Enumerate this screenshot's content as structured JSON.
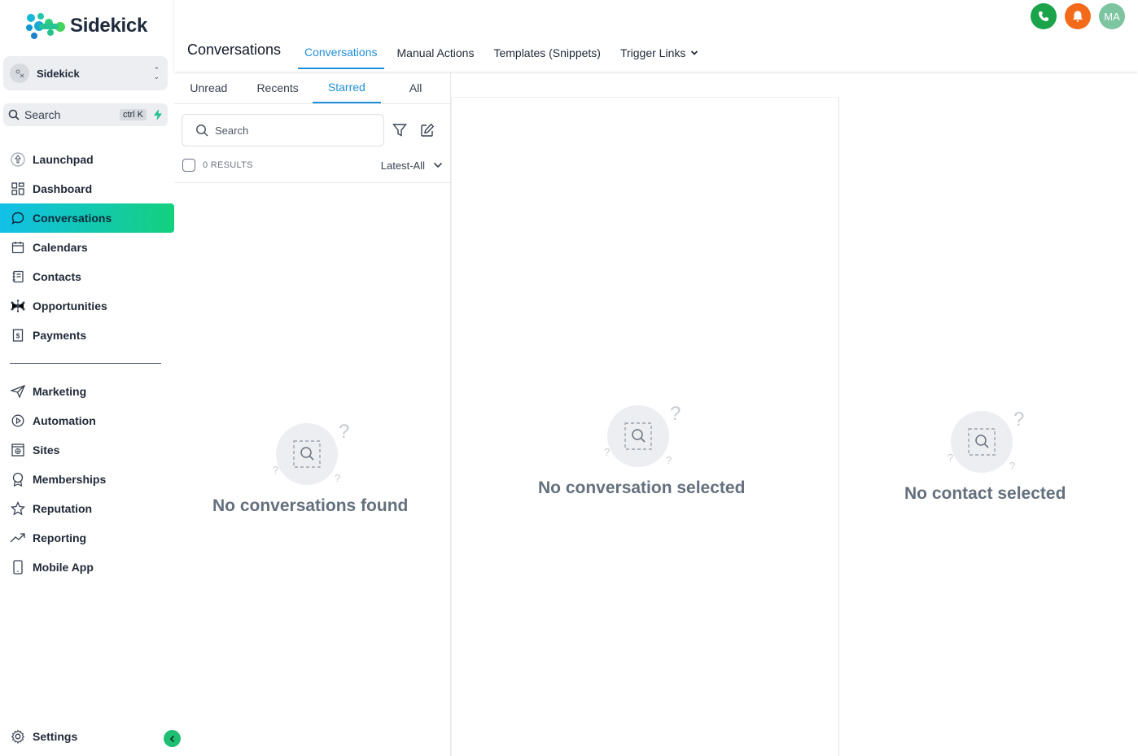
{
  "brand": {
    "name": "Sidekick"
  },
  "account": {
    "name": "Sidekick"
  },
  "sidebar_search": {
    "label": "Search",
    "shortcut": "ctrl K"
  },
  "nav_primary": [
    {
      "label": "Launchpad",
      "icon": "rocket-icon"
    },
    {
      "label": "Dashboard",
      "icon": "grid-icon"
    },
    {
      "label": "Conversations",
      "icon": "chat-bubble-icon",
      "active": true
    },
    {
      "label": "Calendars",
      "icon": "calendar-icon"
    },
    {
      "label": "Contacts",
      "icon": "contacts-book-icon"
    },
    {
      "label": "Opportunities",
      "icon": "network-icon"
    },
    {
      "label": "Payments",
      "icon": "receipt-icon"
    }
  ],
  "nav_secondary": [
    {
      "label": "Marketing",
      "icon": "send-icon"
    },
    {
      "label": "Automation",
      "icon": "play-circle-icon"
    },
    {
      "label": "Sites",
      "icon": "globe-window-icon"
    },
    {
      "label": "Memberships",
      "icon": "badge-icon"
    },
    {
      "label": "Reputation",
      "icon": "star-icon"
    },
    {
      "label": "Reporting",
      "icon": "trend-icon"
    },
    {
      "label": "Mobile App",
      "icon": "phone-device-icon"
    }
  ],
  "settings": {
    "label": "Settings"
  },
  "header": {
    "title": "Conversations",
    "tabs": [
      "Conversations",
      "Manual Actions",
      "Templates (Snippets)",
      "Trigger Links"
    ],
    "avatar_initials": "MA"
  },
  "list": {
    "tabs": [
      "Unread",
      "Recents",
      "Starred",
      "All"
    ],
    "active_tab": "Starred",
    "search_placeholder": "Search",
    "results_label": "0 RESULTS",
    "sort_label": "Latest-All",
    "empty_text": "No conversations found"
  },
  "conversation_panel": {
    "empty_text": "No conversation selected"
  },
  "contact_panel": {
    "empty_text": "No contact selected"
  },
  "colors": {
    "accent": "#1f8fd8",
    "active_gradient_start": "#12c0e8",
    "active_gradient_end": "#13d07d",
    "phone_button": "#1aa34a",
    "bell_button": "#f46a1b",
    "avatar_bg": "#7dc4a0"
  }
}
